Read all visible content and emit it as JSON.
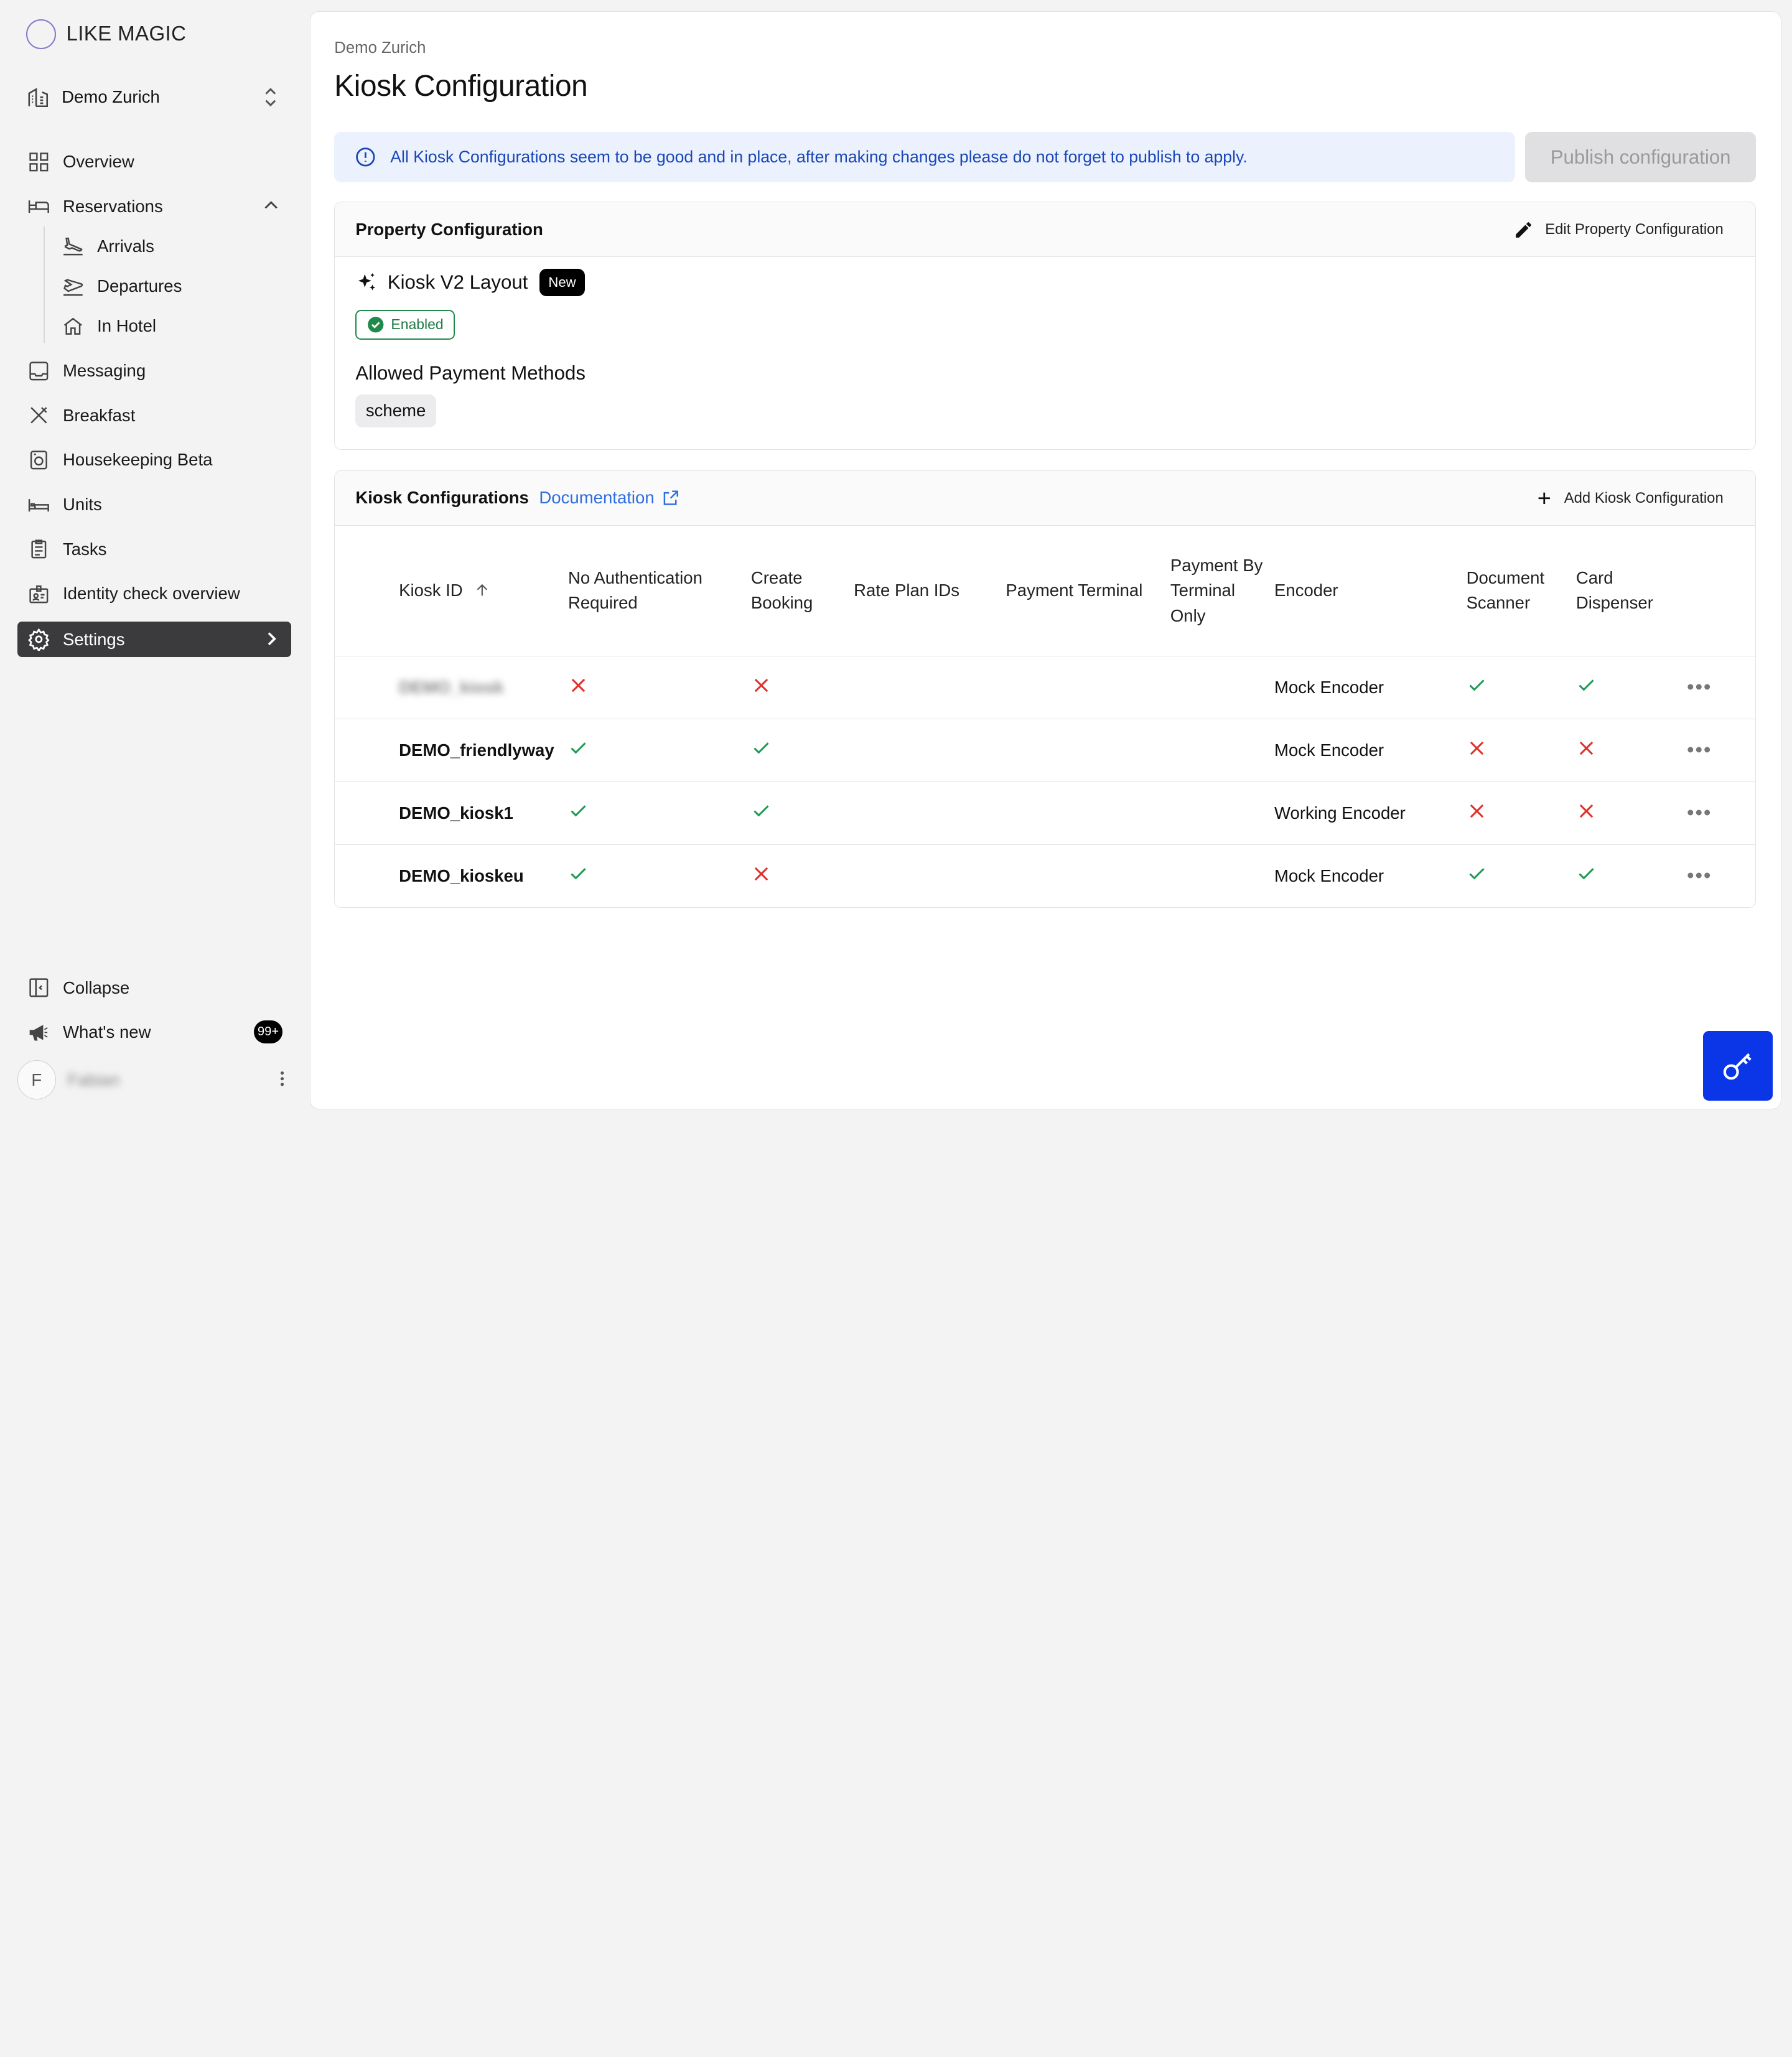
{
  "brand": {
    "name": "LIKE MAGIC"
  },
  "property": {
    "name": "Demo Zurich"
  },
  "nav": {
    "overview": "Overview",
    "reservations": "Reservations",
    "arrivals": "Arrivals",
    "departures": "Departures",
    "in_hotel": "In Hotel",
    "messaging": "Messaging",
    "breakfast": "Breakfast",
    "housekeeping": "Housekeeping Beta",
    "units": "Units",
    "tasks": "Tasks",
    "identity": "Identity check overview",
    "settings": "Settings"
  },
  "footer": {
    "collapse": "Collapse",
    "whats_new": "What's new",
    "whats_new_count": "99+",
    "user_initial": "F",
    "user_name": "Fabian"
  },
  "header": {
    "breadcrumb": "Demo Zurich",
    "title": "Kiosk Configuration"
  },
  "info": {
    "message": "All Kiosk Configurations seem to be good and in place, after making changes please do not forget to publish to apply.",
    "publish_label": "Publish configuration"
  },
  "property_config": {
    "title": "Property Configuration",
    "edit_label": "Edit Property Configuration",
    "layout_label": "Kiosk V2 Layout",
    "new_badge": "New",
    "status": "Enabled",
    "payment_title": "Allowed Payment Methods",
    "payment_methods": [
      "scheme"
    ]
  },
  "kiosk_configs": {
    "title": "Kiosk Configurations",
    "doc_label": "Documentation",
    "add_label": "Add Kiosk Configuration",
    "columns": {
      "kiosk_id": "Kiosk ID",
      "no_auth": "No Authentication Required",
      "create_booking": "Create Booking",
      "rate_plan": "Rate Plan IDs",
      "payment_terminal": "Payment Terminal",
      "payment_only": "Payment By Terminal Only",
      "encoder": "Encoder",
      "doc_scanner": "Document Scanner",
      "card_dispenser": "Card Dispenser"
    },
    "rows": [
      {
        "id": "DEMO_kiosk",
        "no_auth": false,
        "create_booking": false,
        "encoder": "Mock Encoder",
        "doc_scanner": true,
        "card_dispenser": true
      },
      {
        "id": "DEMO_friendlyway",
        "no_auth": true,
        "create_booking": true,
        "encoder": "Mock Encoder",
        "doc_scanner": false,
        "card_dispenser": false
      },
      {
        "id": "DEMO_kiosk1",
        "no_auth": true,
        "create_booking": true,
        "encoder": "Working Encoder",
        "doc_scanner": false,
        "card_dispenser": false
      },
      {
        "id": "DEMO_kioskeu",
        "no_auth": true,
        "create_booking": false,
        "encoder": "Mock Encoder",
        "doc_scanner": true,
        "card_dispenser": true
      }
    ]
  },
  "colors": {
    "accent": "#0a36e8",
    "success": "#1f9a55",
    "error": "#e0302a",
    "link": "#2f6ee0",
    "active_nav": "#3b3b3d"
  },
  "icons": {
    "fab": "key-icon"
  }
}
